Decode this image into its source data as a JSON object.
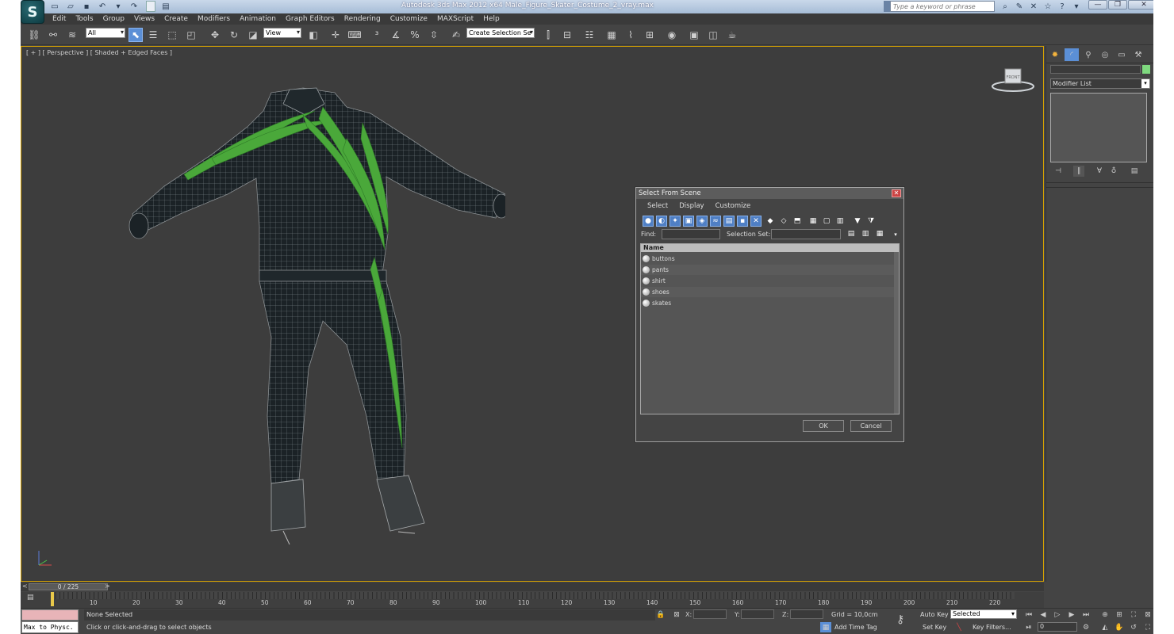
{
  "titlebar": {
    "title": "Autodesk 3ds Max  2012 x64      Male_Figure_Skater_Costume_2_vray.max",
    "search_placeholder": "Type a keyword or phrase"
  },
  "menu": [
    "Edit",
    "Tools",
    "Group",
    "Views",
    "Create",
    "Modifiers",
    "Animation",
    "Graph Editors",
    "Rendering",
    "Customize",
    "MAXScript",
    "Help"
  ],
  "toolbar": {
    "selection_filter": "All",
    "reference_coord": "View",
    "selection_set_placeholder": "Create Selection Se"
  },
  "viewport": {
    "label": "[ + ] [ Perspective ] [ Shaded + Edged Faces ]",
    "viewcube_label": "FRONT"
  },
  "dialog": {
    "title": "Select From Scene",
    "menu": [
      "Select",
      "Display",
      "Customize"
    ],
    "find_label": "Find:",
    "selection_set_label": "Selection Set:",
    "column_name": "Name",
    "items": [
      "buttons",
      "pants",
      "shirt",
      "shoes",
      "skates"
    ],
    "ok_label": "OK",
    "cancel_label": "Cancel"
  },
  "command_panel": {
    "modifier_list": "Modifier List",
    "object_color": "#7fd97f"
  },
  "timeline": {
    "frame_display": "0 / 225",
    "ticks": [
      "10",
      "20",
      "30",
      "40",
      "50",
      "60",
      "70",
      "80",
      "90",
      "100",
      "110",
      "120",
      "130",
      "140",
      "150",
      "160",
      "170",
      "180",
      "190",
      "200",
      "210",
      "220"
    ]
  },
  "status": {
    "maxscript_text": "Max to Physc.",
    "selection_status": "None Selected",
    "prompt": "Click or click-and-drag to select objects",
    "x_label": "X:",
    "y_label": "Y:",
    "z_label": "Z:",
    "grid": "Grid = 10,0cm",
    "add_time_tag": "Add Time Tag",
    "auto_key": "Auto Key",
    "auto_key_mode": "Selected",
    "set_key": "Set Key",
    "key_filters": "Key Filters...",
    "current_frame": "0"
  },
  "colors": {
    "viewport_border": "#d6a200",
    "suit": "#1b2226",
    "wire": "#8a8f92",
    "leaf": "#4aa83a"
  }
}
